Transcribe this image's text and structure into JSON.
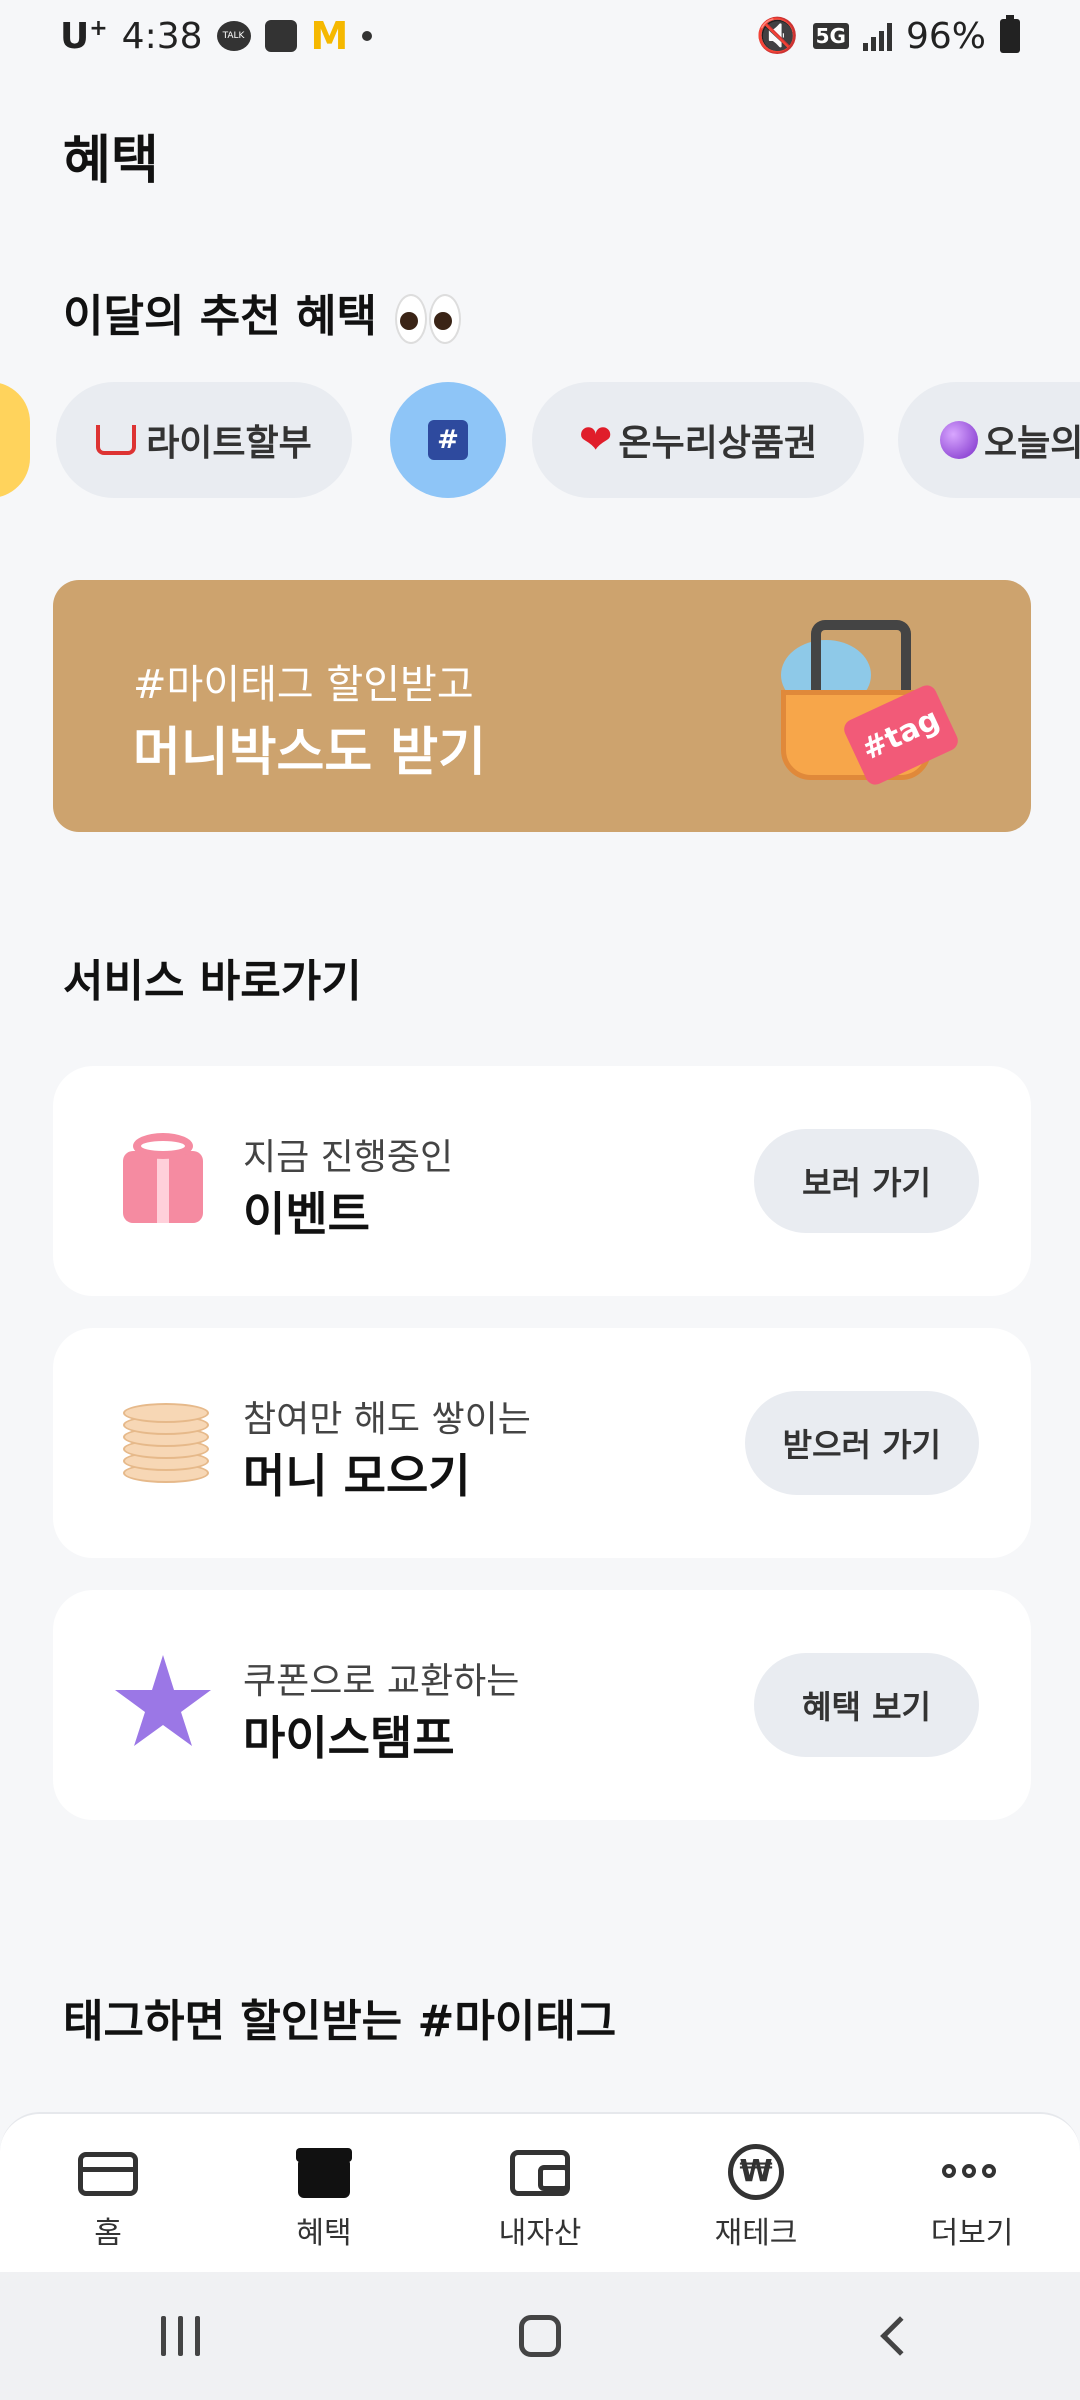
{
  "status_bar": {
    "carrier": "U",
    "carrier_sup": "+",
    "time": "4:38",
    "talk_label": "TALK",
    "mc_glyph": "M",
    "network": "5G",
    "battery": "96%"
  },
  "page": {
    "title": "혜택"
  },
  "recommend": {
    "title": "이달의 추천 혜택",
    "chips": [
      {
        "label": "라이트할부"
      },
      {
        "label": "#"
      },
      {
        "label": "온누리상품권"
      },
      {
        "label": "오늘의"
      }
    ]
  },
  "banner": {
    "subtitle": "#마이태그 할인받고",
    "title": "머니박스도 받기",
    "tag_text": "#tag"
  },
  "services": {
    "title": "서비스 바로가기",
    "items": [
      {
        "sub": "지금 진행중인",
        "main": "이벤트",
        "button": "보러 가기"
      },
      {
        "sub": "참여만 해도 쌓이는",
        "main": "머니 모으기",
        "button": "받으러 가기"
      },
      {
        "sub": "쿠폰으로 교환하는",
        "main": "마이스탬프",
        "button": "혜택 보기"
      }
    ]
  },
  "mytag": {
    "title": "태그하면 할인받는 #마이태그"
  },
  "bottom_nav": {
    "items": [
      {
        "label": "홈",
        "icon": "card-icon"
      },
      {
        "label": "혜택",
        "icon": "gift-icon"
      },
      {
        "label": "내자산",
        "icon": "wallet-icon"
      },
      {
        "label": "재테크",
        "icon": "won-icon"
      },
      {
        "label": "더보기",
        "icon": "more-icon"
      }
    ]
  }
}
